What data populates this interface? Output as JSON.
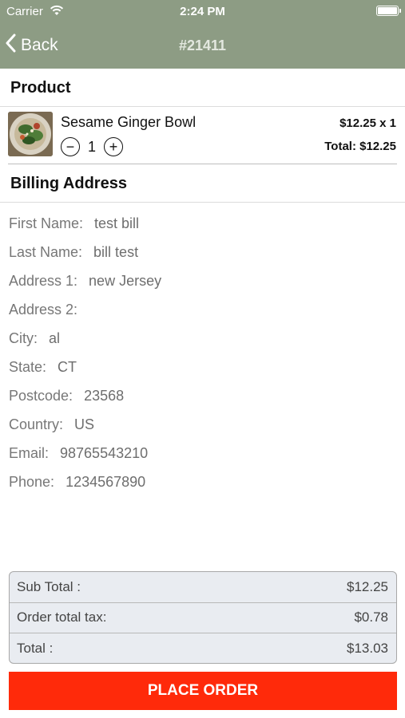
{
  "status_bar": {
    "carrier": "Carrier",
    "time": "2:24 PM"
  },
  "nav": {
    "back_label": "Back",
    "title": "#21411"
  },
  "product_section": {
    "heading": "Product",
    "item": {
      "name": "Sesame Ginger Bowl",
      "quantity": "1",
      "unit_price": "$12.25 x 1",
      "total": "Total: $12.25"
    }
  },
  "billing_section": {
    "heading": "Billing Address",
    "fields": [
      {
        "label": "First Name:",
        "value": "test bill"
      },
      {
        "label": "Last Name:",
        "value": "bill test"
      },
      {
        "label": "Address 1:",
        "value": "new Jersey"
      },
      {
        "label": "Address 2:",
        "value": ""
      },
      {
        "label": "City:",
        "value": "al"
      },
      {
        "label": "State:",
        "value": "CT"
      },
      {
        "label": "Postcode:",
        "value": "23568"
      },
      {
        "label": "Country:",
        "value": "US"
      },
      {
        "label": "Email:",
        "value": "98765543210"
      },
      {
        "label": "Phone:",
        "value": "1234567890"
      }
    ]
  },
  "totals": [
    {
      "label": "Sub Total :",
      "value": "$12.25"
    },
    {
      "label": "Order total tax:",
      "value": "$0.78"
    },
    {
      "label": "Total :",
      "value": "$13.03"
    }
  ],
  "place_order_label": "PLACE ORDER",
  "colors": {
    "nav_bg": "#8d9c84",
    "accent_button": "#ff2a0a",
    "totals_bg": "#e9ecf1"
  }
}
